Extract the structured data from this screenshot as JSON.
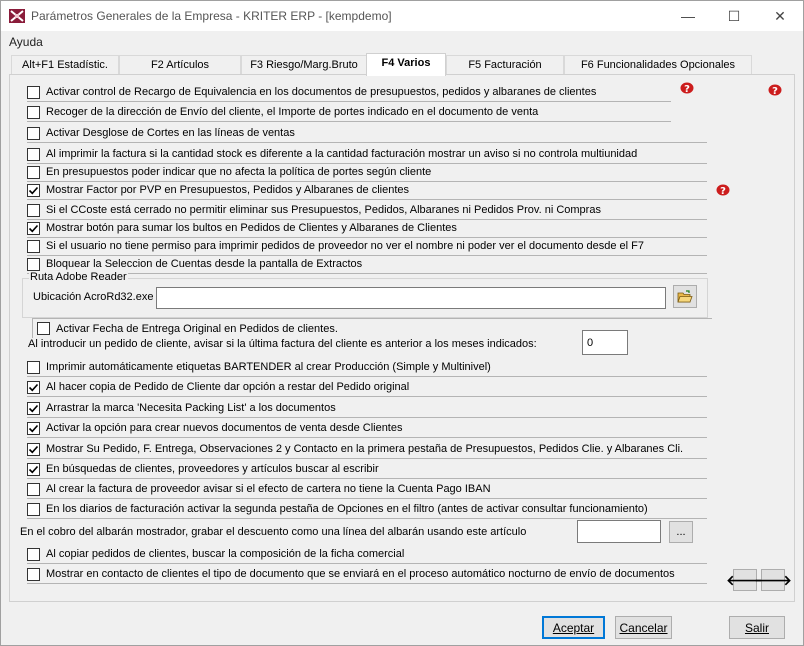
{
  "window": {
    "title": "Parámetros Generales de la Empresa - KRITER ERP - [kempdemo]",
    "minimize_glyph": "—",
    "maximize_glyph": "☐",
    "close_glyph": "✕"
  },
  "menu": {
    "help": "Ayuda"
  },
  "tabs": [
    {
      "label": "Alt+F1 Estadístic."
    },
    {
      "label": "F2 Artículos"
    },
    {
      "label": "F3 Riesgo/Marg.Bruto"
    },
    {
      "label": "F4 Varios"
    },
    {
      "label": "F5 Facturación"
    },
    {
      "label": "F6 Funcionalidades Opcionales"
    }
  ],
  "options": [
    {
      "label": "Activar control de Recargo de Equivalencia en los documentos de presupuestos, pedidos y albaranes de clientes",
      "checked": false
    },
    {
      "label": "Recoger de la dirección de Envío del cliente, el Importe de portes indicado en el documento de venta",
      "checked": false
    },
    {
      "label": "Activar Desglose de Cortes en las líneas de ventas",
      "checked": false
    },
    {
      "label": "Al imprimir la factura si la cantidad stock es diferente a la cantidad facturación mostrar un aviso si no controla multiunidad",
      "checked": false
    },
    {
      "label": "En presupuestos poder indicar que no afecta la política de portes según cliente",
      "checked": false
    },
    {
      "label": "Mostrar Factor por PVP en Presupuestos, Pedidos y Albaranes de clientes",
      "checked": true
    },
    {
      "label": "Si el CCoste está cerrado no permitir eliminar sus Presupuestos, Pedidos, Albaranes ni Pedidos Prov. ni Compras",
      "checked": false
    },
    {
      "label": "Mostrar botón para sumar los bultos en Pedidos de Clientes y Albaranes de Clientes",
      "checked": true
    },
    {
      "label": "Si el usuario no tiene permiso para imprimir pedidos de proveedor no ver el nombre ni poder ver el documento desde el F7",
      "checked": false
    },
    {
      "label": "Bloquear la Seleccion de Cuentas desde la pantalla de Extractos",
      "checked": false
    }
  ],
  "adobe": {
    "group_title": "Ruta Adobe Reader",
    "label": "Ubicación AcroRd32.exe",
    "value": ""
  },
  "fecha_entrega": {
    "label": "Activar Fecha de Entrega Original en Pedidos de clientes.",
    "checked": false
  },
  "meses": {
    "label": "Al introducir un pedido de cliente, avisar si la última factura del cliente es anterior a los meses indicados:",
    "value": "0"
  },
  "options2": [
    {
      "label": "Imprimir automáticamente etiquetas BARTENDER al crear Producción (Simple y Multinivel)",
      "checked": false
    },
    {
      "label": "Al hacer copia de Pedido de Cliente dar opción a restar del Pedido original",
      "checked": true
    },
    {
      "label": "Arrastrar la marca 'Necesita Packing List' a los documentos",
      "checked": true
    },
    {
      "label": "Activar la opción para crear nuevos documentos de venta desde Clientes",
      "checked": true
    },
    {
      "label": "Mostrar Su Pedido, F. Entrega, Observaciones 2 y Contacto en la primera pestaña de Presupuestos, Pedidos Clie. y Albaranes Cli.",
      "checked": true
    },
    {
      "label": "En búsquedas de clientes, proveedores y artículos buscar al escribir",
      "checked": true
    },
    {
      "label": "Al crear la factura de proveedor avisar si el efecto de cartera no tiene la Cuenta Pago IBAN",
      "checked": false
    },
    {
      "label": "En los diarios de facturación activar la segunda pestaña de Opciones en el filtro (antes de activar consultar funcionamiento)",
      "checked": false
    }
  ],
  "cobro": {
    "label": "En el cobro del albarán mostrador, grabar el descuento como una línea del albarán usando este artículo",
    "value": "",
    "browse_label": "..."
  },
  "options3": [
    {
      "label": "Al copiar pedidos de clientes, buscar la composición de la ficha comercial",
      "checked": false
    },
    {
      "label": "Mostrar en contacto de clientes el tipo de documento que se enviará en el proceso automático nocturno de envío de documentos",
      "checked": false
    }
  ],
  "nav": {
    "prev": "🡐",
    "next": "🡒"
  },
  "buttons": {
    "accept": "Aceptar",
    "cancel": "Cancelar",
    "exit": "Salir"
  },
  "icons": {
    "help": "help-question-icon",
    "folder": "open-folder-icon"
  },
  "colors": {
    "accent": "#0078d7",
    "help_red": "#cc1d1d"
  }
}
